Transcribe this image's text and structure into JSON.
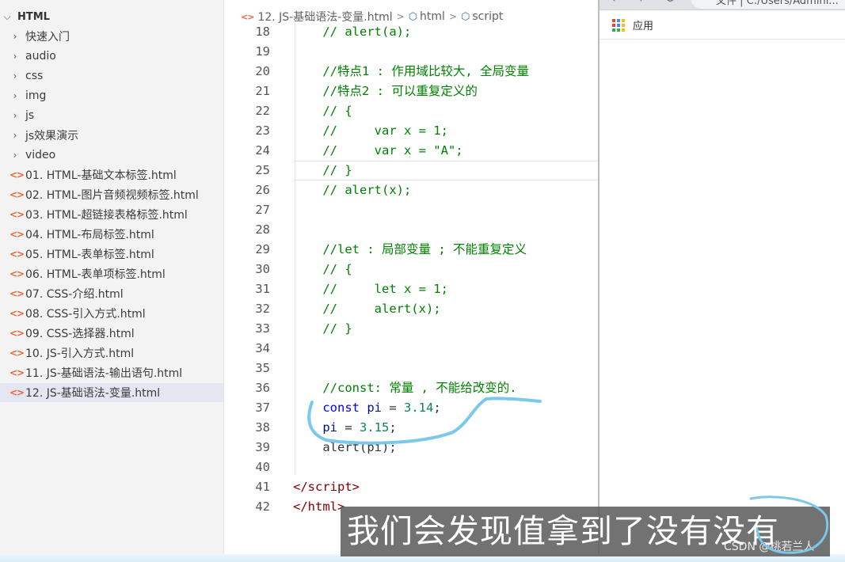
{
  "explorer": {
    "root_label": "HTML",
    "folders": [
      "快速入门",
      "audio",
      "css",
      "img",
      "js",
      "js效果演示",
      "video"
    ],
    "files": [
      "01. HTML-基础文本标签.html",
      "02. HTML-图片音频视频标签.html",
      "03. HTML-超链接表格标签.html",
      "04. HTML-布局标签.html",
      "05. HTML-表单标签.html",
      "06. HTML-表单项标签.html",
      "07. CSS-介绍.html",
      "08. CSS-引入方式.html",
      "09. CSS-选择器.html",
      "10. JS-引入方式.html",
      "11. JS-基础语法-输出语句.html",
      "12. JS-基础语法-变量.html"
    ],
    "active_file": "12. JS-基础语法-变量.html"
  },
  "editor": {
    "breadcrumb": {
      "file": "12. JS-基础语法-变量.html",
      "html": "html",
      "script": "script"
    },
    "current_line": "25",
    "lines": [
      {
        "num": "18",
        "segments": [
          {
            "t": "    // alert(a);",
            "k": "comment"
          }
        ]
      },
      {
        "num": "19",
        "segments": []
      },
      {
        "num": "20",
        "segments": [
          {
            "t": "    //特点1 : 作用域比较大, 全局变量",
            "k": "comment"
          }
        ]
      },
      {
        "num": "21",
        "segments": [
          {
            "t": "    //特点2 : 可以重复定义的",
            "k": "comment"
          }
        ]
      },
      {
        "num": "22",
        "segments": [
          {
            "t": "    // {",
            "k": "comment"
          }
        ]
      },
      {
        "num": "23",
        "segments": [
          {
            "t": "    //     var x = 1;",
            "k": "comment"
          }
        ]
      },
      {
        "num": "24",
        "segments": [
          {
            "t": "    //     var x = \"A\";",
            "k": "comment"
          }
        ]
      },
      {
        "num": "25",
        "segments": [
          {
            "t": "    // }",
            "k": "comment"
          }
        ]
      },
      {
        "num": "26",
        "segments": [
          {
            "t": "    // alert(x);",
            "k": "comment"
          }
        ]
      },
      {
        "num": "27",
        "segments": []
      },
      {
        "num": "28",
        "segments": []
      },
      {
        "num": "29",
        "segments": [
          {
            "t": "    //let : 局部变量 ; 不能重复定义",
            "k": "comment"
          }
        ]
      },
      {
        "num": "30",
        "segments": [
          {
            "t": "    // {",
            "k": "comment"
          }
        ]
      },
      {
        "num": "31",
        "segments": [
          {
            "t": "    //     let x = 1;",
            "k": "comment"
          }
        ]
      },
      {
        "num": "32",
        "segments": [
          {
            "t": "    //     alert(x);",
            "k": "comment"
          }
        ]
      },
      {
        "num": "33",
        "segments": [
          {
            "t": "    // }",
            "k": "comment"
          }
        ]
      },
      {
        "num": "34",
        "segments": []
      },
      {
        "num": "35",
        "segments": []
      },
      {
        "num": "36",
        "segments": [
          {
            "t": "    //const: 常量 , 不能给改变的.",
            "k": "comment"
          }
        ]
      },
      {
        "num": "37",
        "segments": [
          {
            "t": "    ",
            "k": "plain"
          },
          {
            "t": "const",
            "k": "kw"
          },
          {
            "t": " pi",
            "k": "var"
          },
          {
            "t": " = ",
            "k": "plain"
          },
          {
            "t": "3.14",
            "k": "num"
          },
          {
            "t": ";",
            "k": "plain"
          }
        ]
      },
      {
        "num": "38",
        "segments": [
          {
            "t": "    ",
            "k": "plain"
          },
          {
            "t": "pi",
            "k": "var"
          },
          {
            "t": " = ",
            "k": "plain"
          },
          {
            "t": "3.15",
            "k": "num"
          },
          {
            "t": ";",
            "k": "plain"
          }
        ]
      },
      {
        "num": "39",
        "segments": [
          {
            "t": "    alert(pi);",
            "k": "plain"
          }
        ]
      },
      {
        "num": "40",
        "segments": []
      },
      {
        "num": "41",
        "segments": [
          {
            "t": "</",
            "k": "punct"
          },
          {
            "t": "script",
            "k": "tag"
          },
          {
            "t": ">",
            "k": "punct"
          }
        ]
      },
      {
        "num": "42",
        "segments": [
          {
            "t": "</",
            "k": "punct"
          },
          {
            "t": "html",
            "k": "tag"
          },
          {
            "t": ">",
            "k": "punct"
          }
        ]
      }
    ]
  },
  "browser": {
    "address_text": "文件 | C:/Users/Admini...",
    "bookmarks_apps": "应用"
  },
  "overlay": {
    "subtitle": "我们会发现值拿到了没有没有",
    "watermark": "CSDN @桃若兰人"
  },
  "colors": {
    "sidebar_bg": "#f3f3f3",
    "active_row": "#e4e6f1",
    "comment": "#008000",
    "keyword": "#0000ff",
    "number": "#098658",
    "tag": "#800000",
    "annotation_stroke": "#7cc8ec"
  }
}
